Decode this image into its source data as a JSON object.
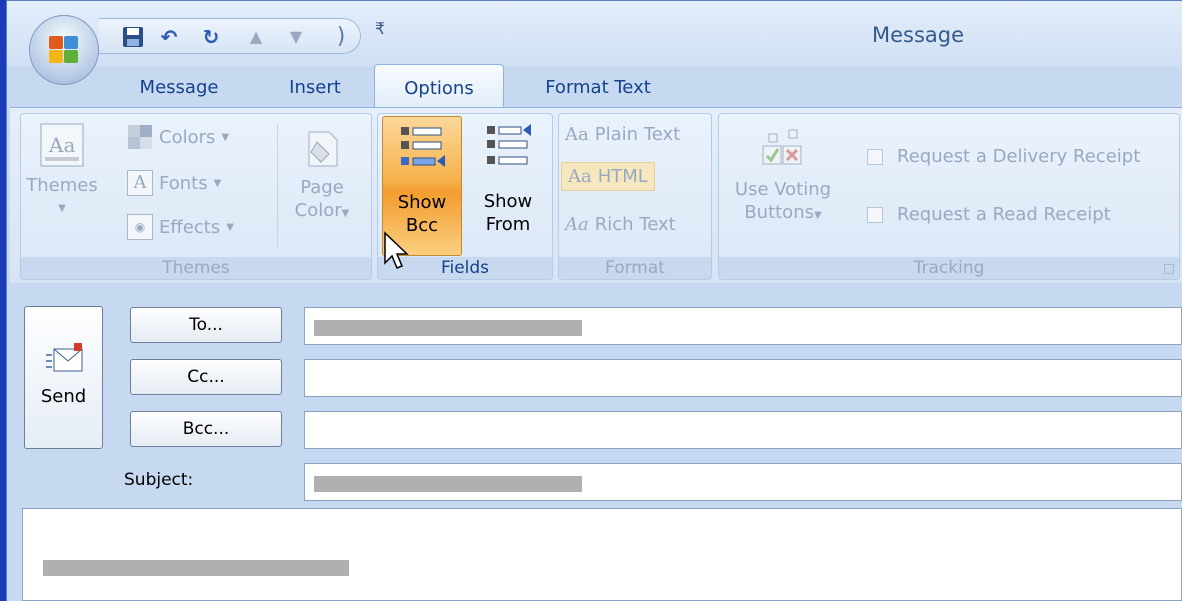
{
  "window": {
    "title": "Message"
  },
  "quick_access": {
    "icons": [
      "office-logo-icon",
      "save-icon",
      "undo-icon",
      "redo-icon",
      "up-arrow-icon",
      "down-arrow-icon",
      "customize-dropdown-icon"
    ]
  },
  "tabs": [
    {
      "label": "Message",
      "active": false
    },
    {
      "label": "Insert",
      "active": false
    },
    {
      "label": "Options",
      "active": true
    },
    {
      "label": "Format Text",
      "active": false
    }
  ],
  "ribbon": {
    "themes_group": {
      "label": "Themes",
      "themes_button": "Themes",
      "colors": "Colors",
      "fonts": "Fonts",
      "effects": "Effects",
      "page_color_line1": "Page",
      "page_color_line2": "Color"
    },
    "fields_group": {
      "label": "Fields",
      "show_bcc_line1": "Show",
      "show_bcc_line2": "Bcc",
      "show_from_line1": "Show",
      "show_from_line2": "From"
    },
    "format_group": {
      "label": "Format",
      "plain_text": "Plain Text",
      "html": "HTML",
      "rich_text": "Rich Text",
      "plain_prefix": "Aa",
      "html_prefix": "Aa",
      "rich_prefix": "Aa"
    },
    "tracking_group": {
      "label": "Tracking",
      "voting_line1": "Use Voting",
      "voting_line2": "Buttons",
      "delivery_receipt": "Request a Delivery Receipt",
      "read_receipt": "Request a Read Receipt"
    }
  },
  "compose": {
    "send_label": "Send",
    "to_label": "To...",
    "cc_label": "Cc...",
    "bcc_label": "Bcc...",
    "subject_label": "Subject:"
  },
  "colors": {
    "accent": "#15428b",
    "ribbon_bg": "#d7e4f5",
    "pressed_orange": "#f7b24d",
    "frame_blue": "#c6d9f1"
  }
}
